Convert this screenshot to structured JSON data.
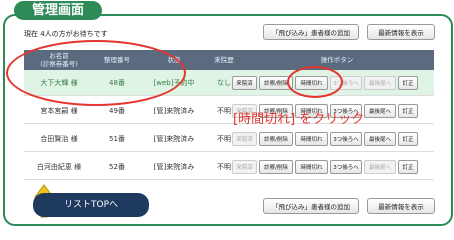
{
  "header": {
    "title": "管理画面"
  },
  "status_text": "現在 4人の方がお待ちです",
  "buttons": {
    "add_walkin_top": "「飛び込み」患者様の追加",
    "refresh_top": "最新情報を表示",
    "add_walkin_bottom": "「飛び込み」患者様の追加",
    "refresh_bottom": "最新情報を表示",
    "list_top": "リストTOPへ"
  },
  "table": {
    "columns": {
      "name_line1": "お名前",
      "name_line2": "(診察券番号)",
      "number": "整理番号",
      "state": "状態",
      "last_visit": "来院歴",
      "operations": "操作ボタン"
    },
    "op_labels": {
      "arrived": "来院済",
      "exam_delete": "診察/削除",
      "timeout": "時間切れ",
      "three_back": "3つ後ろへ",
      "to_end": "最後尾へ",
      "correct": "訂正"
    },
    "rows": [
      {
        "name": "大下大輝 様",
        "number": "48番",
        "state": "[web]予約中",
        "last_visit": "なし"
      },
      {
        "name": "宮本宮嗣 様",
        "number": "49番",
        "state": "[管]来院済み",
        "last_visit": "不明"
      },
      {
        "name": "合田賢治 様",
        "number": "51番",
        "state": "[管]来院済み",
        "last_visit": "不明"
      },
      {
        "name": "白河由紀恵 様",
        "number": "52番",
        "state": "[管]来院済み",
        "last_visit": "不明"
      }
    ]
  },
  "annotation": "[時間切れ] をクリック",
  "colors": {
    "accent": "#2e8b57",
    "highlight_row": "#dff4e4",
    "annotation": "#e4362f",
    "header": "#5b6a7f"
  }
}
